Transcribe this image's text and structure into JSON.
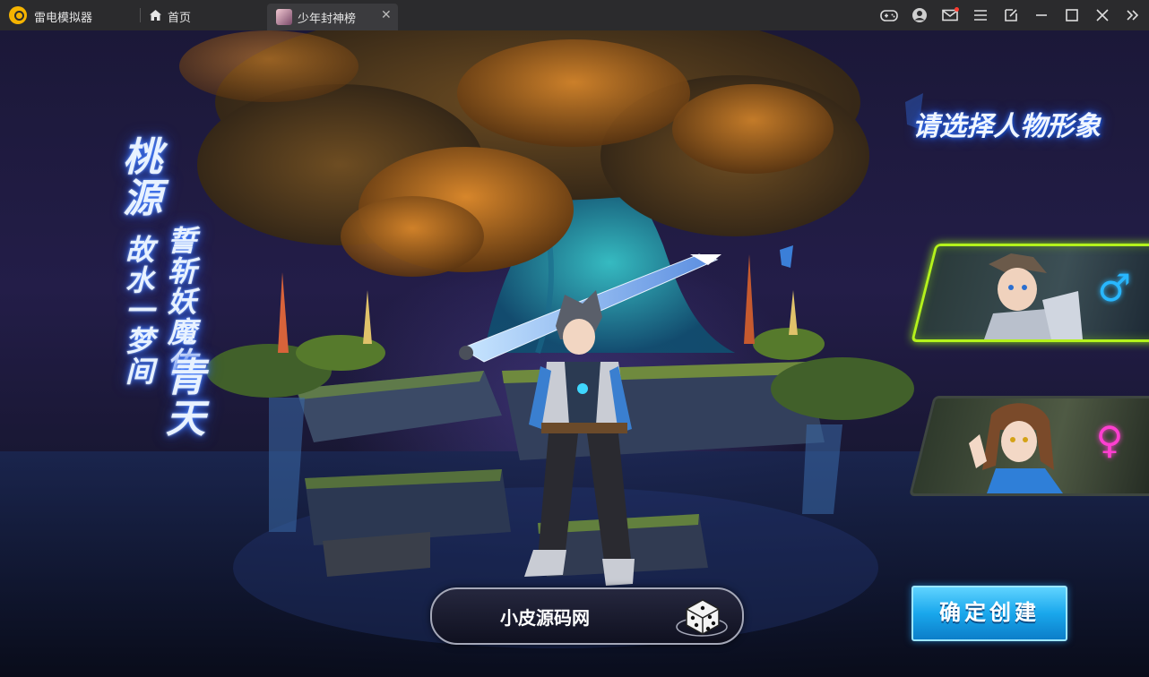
{
  "window": {
    "app_name": "雷电模拟器",
    "tabs": [
      {
        "label": "首页",
        "icon": "home-icon"
      },
      {
        "label": "少年封神榜",
        "icon": "game-icon",
        "active": true
      }
    ],
    "toolbar_icons": [
      "gamepad-icon",
      "user-icon",
      "mail-icon",
      "menu-icon",
      "popout-icon",
      "minimize-icon",
      "maximize-icon",
      "close-icon",
      "expand-icon"
    ]
  },
  "game": {
    "poem": {
      "line1_big": "桃源",
      "line1_small": "故水一梦间",
      "line2_small": "誓斩妖魔佑",
      "line2_big": "青天"
    },
    "select_title": "请选择人物形象",
    "characters": [
      {
        "gender": "male",
        "symbol": "♂",
        "selected": true,
        "accent": "#b4f21c"
      },
      {
        "gender": "female",
        "symbol": "♀",
        "selected": false,
        "accent": "#ff3fd0"
      }
    ],
    "name_value": "小皮源码网",
    "confirm_label": "确定创建"
  },
  "colors": {
    "titlebar_bg": "#2b2b2d",
    "male_accent": "#28b7ff",
    "female_accent": "#ff3fd0",
    "selected_border": "#b4f21c",
    "confirm_bg": "#19a7ec"
  }
}
